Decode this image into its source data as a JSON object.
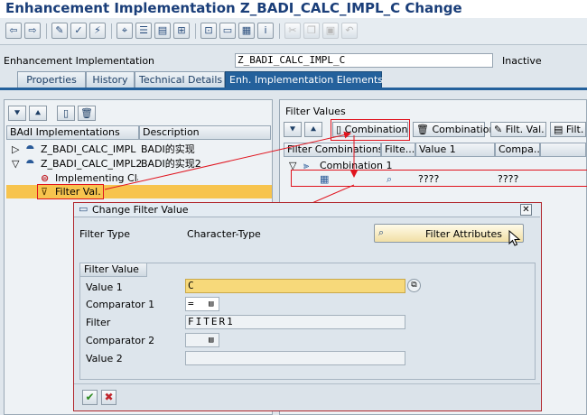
{
  "window": {
    "title": "Enhancement Implementation Z_BADI_CALC_IMPL_C Change"
  },
  "header": {
    "label": "Enhancement Implementation",
    "value": "Z_BADI_CALC_IMPL_C",
    "status": "Inactive"
  },
  "tabs": [
    {
      "label": "Properties"
    },
    {
      "label": "History"
    },
    {
      "label": "Technical Details"
    },
    {
      "label": "Enh. Implementation Elements"
    }
  ],
  "left_panel": {
    "columns": [
      "BAdI Implementations",
      "Description"
    ],
    "rows": [
      {
        "name": "Z_BADI_CALC_IMPL",
        "desc": "BADI的实现"
      },
      {
        "name": "Z_BADI_CALC_IMPL2",
        "desc": "BADI的实现2"
      },
      {
        "name": "Implementing Class",
        "desc": ""
      },
      {
        "name": "Filter Val.",
        "desc": ""
      }
    ]
  },
  "right_panel": {
    "title": "Filter Values",
    "buttons": [
      "Combination",
      "Combination",
      "Filt. Val.",
      "Filt. V"
    ],
    "columns": [
      "Filter Combinations",
      "Filte...",
      "Value 1",
      "Compa..."
    ],
    "group": "Combination 1",
    "row": {
      "value1": "????",
      "compa": "????"
    }
  },
  "dialog": {
    "title": "Change Filter Value",
    "filter_type_label": "Filter Type",
    "filter_type_value": "Character-Type",
    "filter_attributes_button": "Filter Attributes",
    "group_title": "Filter Value",
    "fields": {
      "value1_label": "Value 1",
      "value1": "C",
      "comparator1_label": "Comparator 1",
      "comparator1": "=",
      "filter_label": "Filter",
      "filter": "FITER1",
      "comparator2_label": "Comparator 2",
      "comparator2": "",
      "value2_label": "Value 2",
      "value2": ""
    }
  },
  "colors": {
    "accent": "#24619c",
    "selection": "#f7c44e",
    "highlight": "#e0141e",
    "title": "#1a3e79"
  }
}
